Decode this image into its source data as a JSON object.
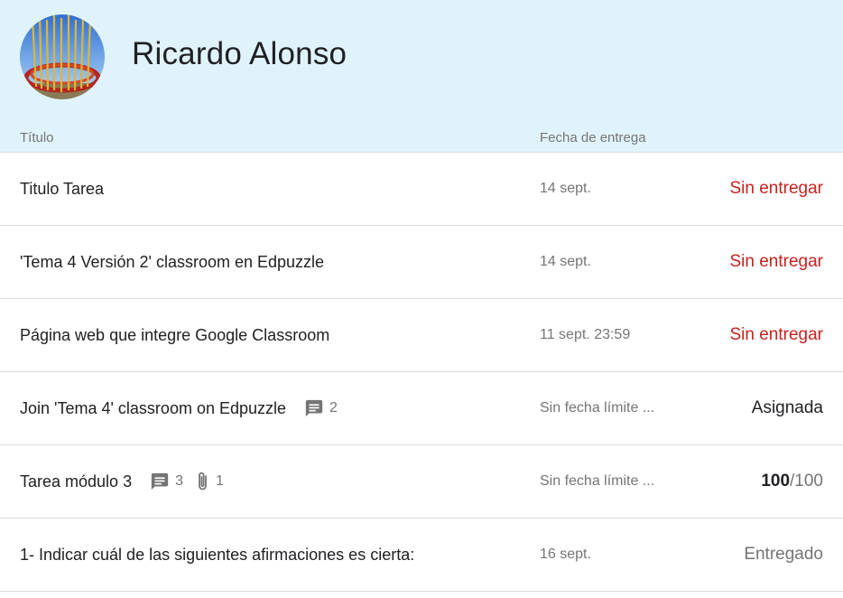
{
  "student": {
    "name": "Ricardo Alonso"
  },
  "columns": {
    "title": "Título",
    "due_date": "Fecha de entrega"
  },
  "assignments": [
    {
      "title": "Titulo Tarea",
      "due": "14 sept.",
      "status": "Sin entregar"
    },
    {
      "title": "'Tema 4 Versión 2' classroom en Edpuzzle",
      "due": "14 sept.",
      "status": "Sin entregar"
    },
    {
      "title": "Página web que integre Google Classroom",
      "due": "11 sept. 23:59",
      "status": "Sin entregar"
    },
    {
      "title": "Join 'Tema 4' classroom on Edpuzzle",
      "comments": "2",
      "due": "Sin fecha límite ...",
      "status": "Asignada"
    },
    {
      "title": "Tarea módulo 3",
      "comments": "3",
      "attachments": "1",
      "due": "Sin fecha límite ...",
      "grade": "100",
      "grade_max": "/100"
    },
    {
      "title": "1- Indicar cuál de las siguientes afirmaciones es cierta:",
      "due": "16 sept.",
      "status": "Entregado"
    }
  ],
  "colors": {
    "header_bg": "#e0f3fc",
    "missing": "#c5221f",
    "muted": "#757575",
    "divider": "#dadce0"
  },
  "icons": {
    "comment": "comment-icon",
    "attachment": "paperclip-icon"
  }
}
